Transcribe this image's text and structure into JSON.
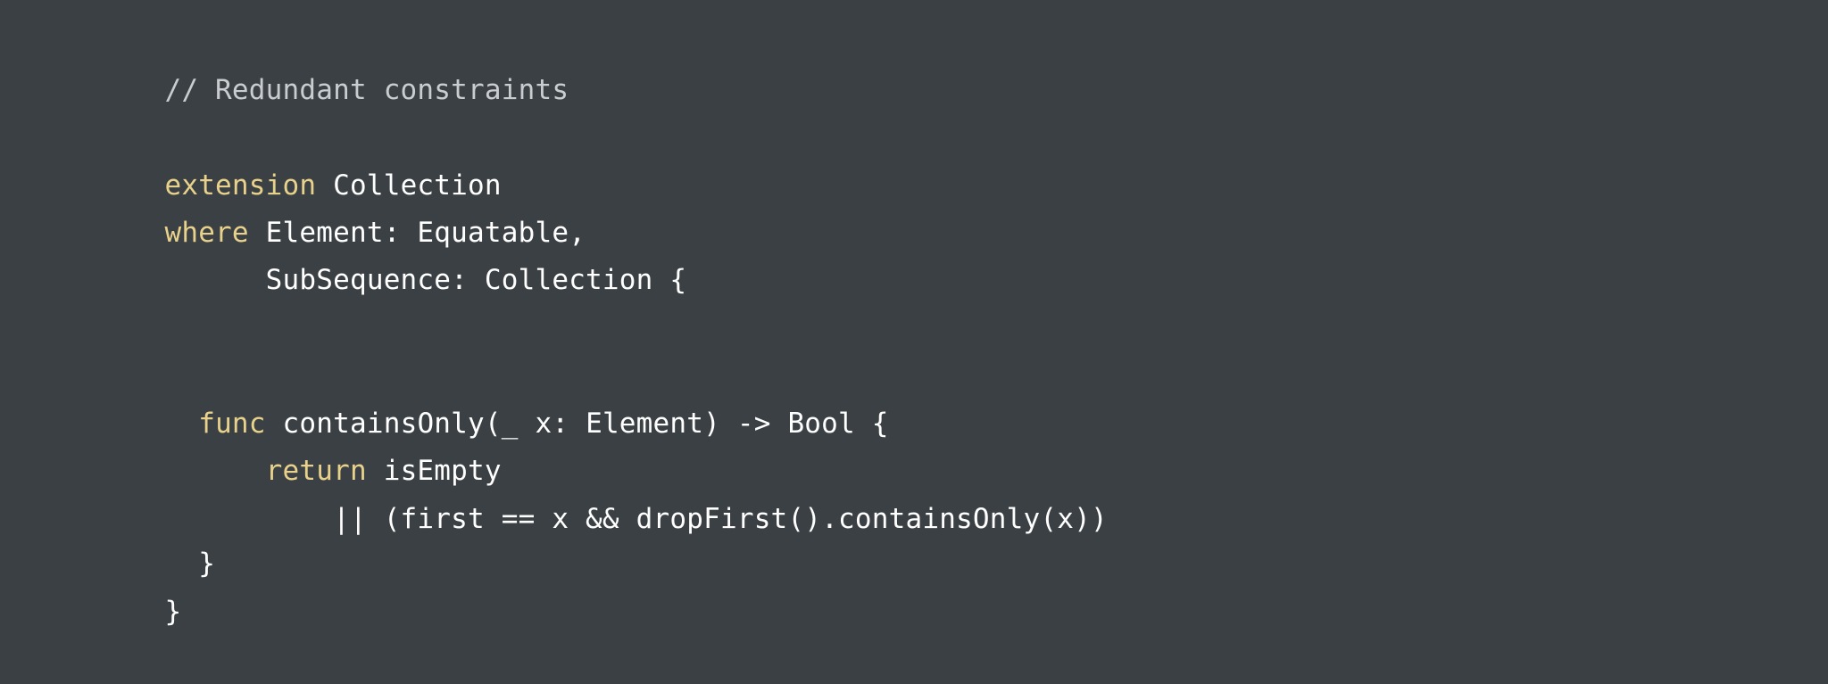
{
  "colors": {
    "background": "#3a4043",
    "comment": "#c9cdcf",
    "keyword": "#e8d18b",
    "text": "#ffffff"
  },
  "code": {
    "lines": [
      {
        "segments": [
          {
            "type": "comment",
            "text": "// Redundant constraints"
          }
        ]
      },
      {
        "segments": [
          {
            "type": "keyword",
            "text": "extension"
          },
          {
            "type": "plain",
            "text": " Collection"
          }
        ]
      },
      {
        "segments": [
          {
            "type": "keyword",
            "text": "where"
          },
          {
            "type": "plain",
            "text": " Element: Equatable,"
          }
        ]
      },
      {
        "segments": [
          {
            "type": "plain",
            "text": "      SubSequence: Collection {"
          }
        ]
      },
      {
        "segments": [
          {
            "type": "plain",
            "text": "  "
          },
          {
            "type": "keyword",
            "text": "func"
          },
          {
            "type": "plain",
            "text": " containsOnly(_ x: Element) -> Bool {"
          }
        ]
      },
      {
        "segments": [
          {
            "type": "plain",
            "text": "      "
          },
          {
            "type": "keyword",
            "text": "return"
          },
          {
            "type": "plain",
            "text": " isEmpty"
          }
        ]
      },
      {
        "segments": [
          {
            "type": "plain",
            "text": "          || (first == x && dropFirst().containsOnly(x))"
          }
        ]
      },
      {
        "segments": [
          {
            "type": "plain",
            "text": "  }"
          }
        ]
      },
      {
        "segments": [
          {
            "type": "plain",
            "text": "}"
          }
        ]
      }
    ]
  }
}
